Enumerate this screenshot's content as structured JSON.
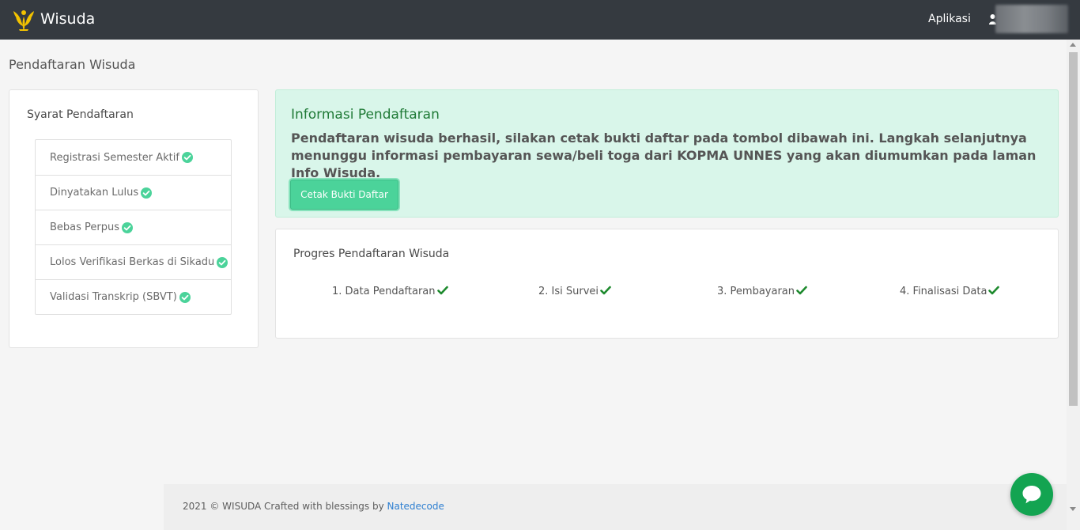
{
  "header": {
    "brand": "Wisuda",
    "nav_app": "Aplikasi",
    "logo_icon": "university-logo-icon",
    "user_icon": "user-icon"
  },
  "page": {
    "title": "Pendaftaran Wisuda"
  },
  "requirements": {
    "title": "Syarat Pendaftaran",
    "items": [
      {
        "label": "Registrasi Semester Aktif",
        "status_icon": "check-circle-icon"
      },
      {
        "label": "Dinyatakan Lulus",
        "status_icon": "check-circle-icon"
      },
      {
        "label": "Bebas Perpus",
        "status_icon": "check-circle-icon"
      },
      {
        "label": "Lolos Verifikasi Berkas di Sikadu",
        "status_icon": "check-circle-icon"
      },
      {
        "label": "Validasi Transkrip (SBVT)",
        "status_icon": "check-circle-icon"
      }
    ]
  },
  "info": {
    "title": "Informasi Pendaftaran",
    "message": "Pendaftaran wisuda berhasil, silakan cetak bukti daftar pada tombol dibawah ini. Langkah selanjutnya menunggu informasi pembayaran sewa/beli toga dari KOPMA UNNES yang akan diumumkan pada laman Info Wisuda.",
    "button_label": "Cetak Bukti Daftar"
  },
  "progress": {
    "title": "Progres Pendaftaran Wisuda",
    "steps": [
      {
        "label": "1. Data Pendaftaran",
        "status_icon": "check-icon"
      },
      {
        "label": "2. Isi Survei",
        "status_icon": "check-icon"
      },
      {
        "label": "3. Pembayaran",
        "status_icon": "check-icon"
      },
      {
        "label": "4. Finalisasi Data",
        "status_icon": "check-icon"
      }
    ]
  },
  "footer": {
    "text": "2021 © WISUDA Crafted with blessings by ",
    "link": "Natedecode"
  },
  "chat": {
    "icon": "chat-bubble-icon"
  },
  "colors": {
    "navbar": "#353a40",
    "success_bg": "#d9f6ea",
    "success_title": "#1f7a36",
    "button": "#4bd39a",
    "check": "#1e8a2e",
    "chat": "#13a451"
  }
}
